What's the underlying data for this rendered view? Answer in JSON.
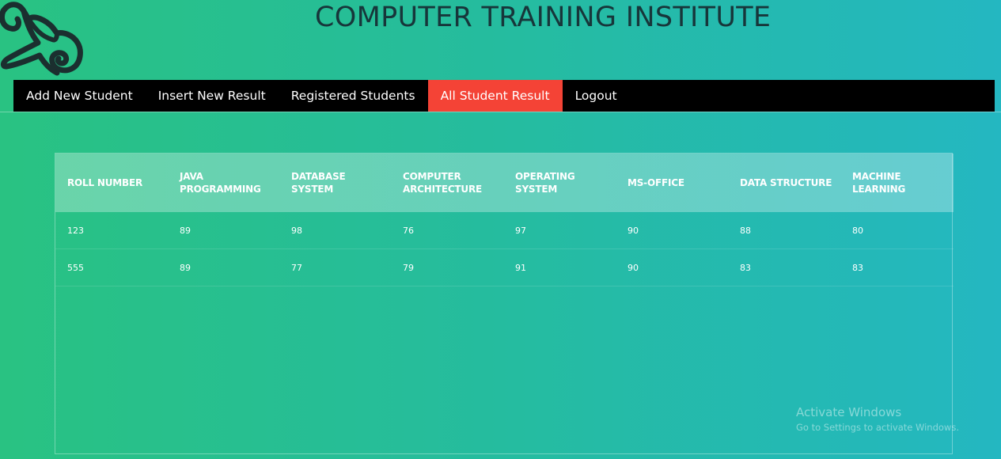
{
  "header": {
    "title": "COMPUTER TRAINING INSTITUTE",
    "logo_icon": "scroll-icon"
  },
  "nav": {
    "items": [
      {
        "label": "Add New Student",
        "active": false
      },
      {
        "label": "Insert New Result",
        "active": false
      },
      {
        "label": "Registered Students",
        "active": false
      },
      {
        "label": "All Student Result",
        "active": true
      },
      {
        "label": "Logout",
        "active": false
      }
    ],
    "active_color": "#f44336"
  },
  "results_table": {
    "columns": [
      "ROLL NUMBER",
      "JAVA PROGRAMMING",
      "DATABASE SYSTEM",
      "COMPUTER ARCHITECTURE",
      "OPERATING SYSTEM",
      "MS-OFFICE",
      "DATA STRUCTURE",
      "MACHINE LEARNING"
    ],
    "rows": [
      [
        "123",
        "89",
        "98",
        "76",
        "97",
        "90",
        "88",
        "80"
      ],
      [
        "555",
        "89",
        "77",
        "79",
        "91",
        "90",
        "83",
        "83"
      ]
    ]
  },
  "watermark": {
    "title": "Activate Windows",
    "subtitle": "Go to Settings to activate Windows."
  },
  "colors": {
    "gradient_start": "#29c282",
    "gradient_end": "#24b7c1",
    "title_color": "#17363a",
    "nav_background": "#000000"
  }
}
